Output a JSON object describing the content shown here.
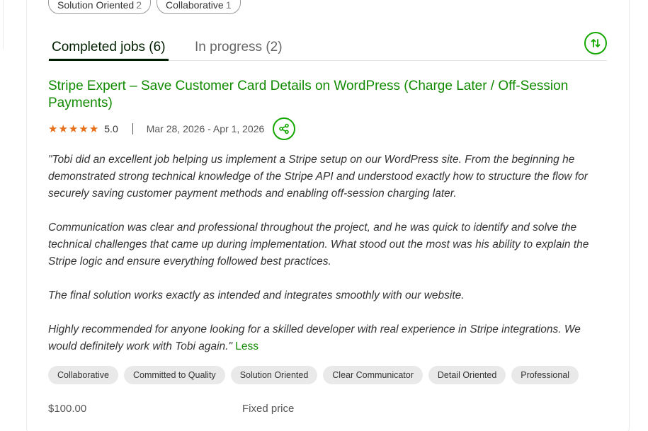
{
  "top_chips": [
    {
      "label": "Solution Oriented",
      "count": "2"
    },
    {
      "label": "Collaborative",
      "count": "1"
    }
  ],
  "tabs": {
    "completed": "Completed jobs (6)",
    "in_progress": "In progress (2)"
  },
  "icons": {
    "sort": "sort-arrows-icon",
    "share": "share-icon",
    "star": "star-icon"
  },
  "colors": {
    "brand_green": "#14a800",
    "title_green": "#108a00",
    "star_orange": "#e86e17",
    "chip_bg": "#e9e9e9"
  },
  "job": {
    "title": "Stripe Expert – Save Customer Card Details on WordPress (Charge Later / Off-Session Payments)",
    "rating": "5.0",
    "stars": 5,
    "dates": "Mar 28, 2026 - Apr 1, 2026",
    "review": [
      "\"Tobi did an excellent job helping us implement a Stripe setup on our WordPress site. From the beginning he demonstrated strong technical knowledge of the Stripe API and understood exactly how to structure the flow for securely saving customer payment methods and enabling off-session charging later.",
      "Communication was clear and professional throughout the project, and he was quick to identify and solve the technical challenges that came up during implementation. What stood out the most was his ability to explain the Stripe logic and ensure everything followed best practices.",
      "The final solution works exactly as intended and integrates smoothly with our website.",
      "Highly recommended for anyone looking for a skilled developer with real experience in Stripe integrations. We would definitely work with Tobi again.\""
    ],
    "less_label": "Less",
    "skills": [
      "Collaborative",
      "Committed to Quality",
      "Solution Oriented",
      "Clear Communicator",
      "Detail Oriented",
      "Professional"
    ],
    "price": "$100.00",
    "price_type": "Fixed price"
  }
}
